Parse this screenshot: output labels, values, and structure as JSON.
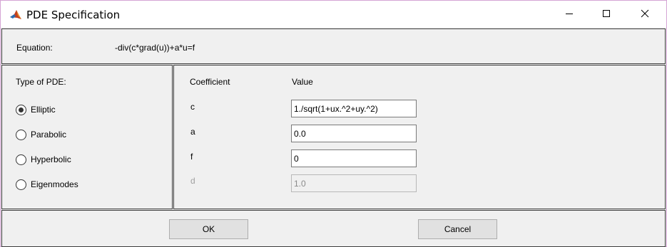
{
  "window": {
    "title": "PDE Specification",
    "app_icon": "matlab-icon"
  },
  "titlebar_buttons": [
    {
      "name": "minimize",
      "icon": "minimize-icon"
    },
    {
      "name": "maximize",
      "icon": "maximize-icon"
    },
    {
      "name": "close",
      "icon": "close-icon"
    }
  ],
  "equation": {
    "label": "Equation:",
    "value": "-div(c*grad(u))+a*u=f"
  },
  "pde_type": {
    "title": "Type of PDE:",
    "options": [
      {
        "label": "Elliptic",
        "selected": true
      },
      {
        "label": "Parabolic",
        "selected": false
      },
      {
        "label": "Hyperbolic",
        "selected": false
      },
      {
        "label": "Eigenmodes",
        "selected": false
      }
    ]
  },
  "coefficients": {
    "header_name": "Coefficient",
    "header_value": "Value",
    "rows": [
      {
        "name": "c",
        "value": "1./sqrt(1+ux.^2+uy.^2)",
        "enabled": true
      },
      {
        "name": "a",
        "value": "0.0",
        "enabled": true
      },
      {
        "name": "f",
        "value": "0",
        "enabled": true
      },
      {
        "name": "d",
        "value": "1.0",
        "enabled": false
      }
    ]
  },
  "buttons": {
    "ok_label": "OK",
    "cancel_label": "Cancel"
  },
  "colors": {
    "panel_bg": "#f0f0f0",
    "border": "#3c3c3c",
    "window_border": "#d4a5d4",
    "disabled_text": "#a0a0a0"
  }
}
